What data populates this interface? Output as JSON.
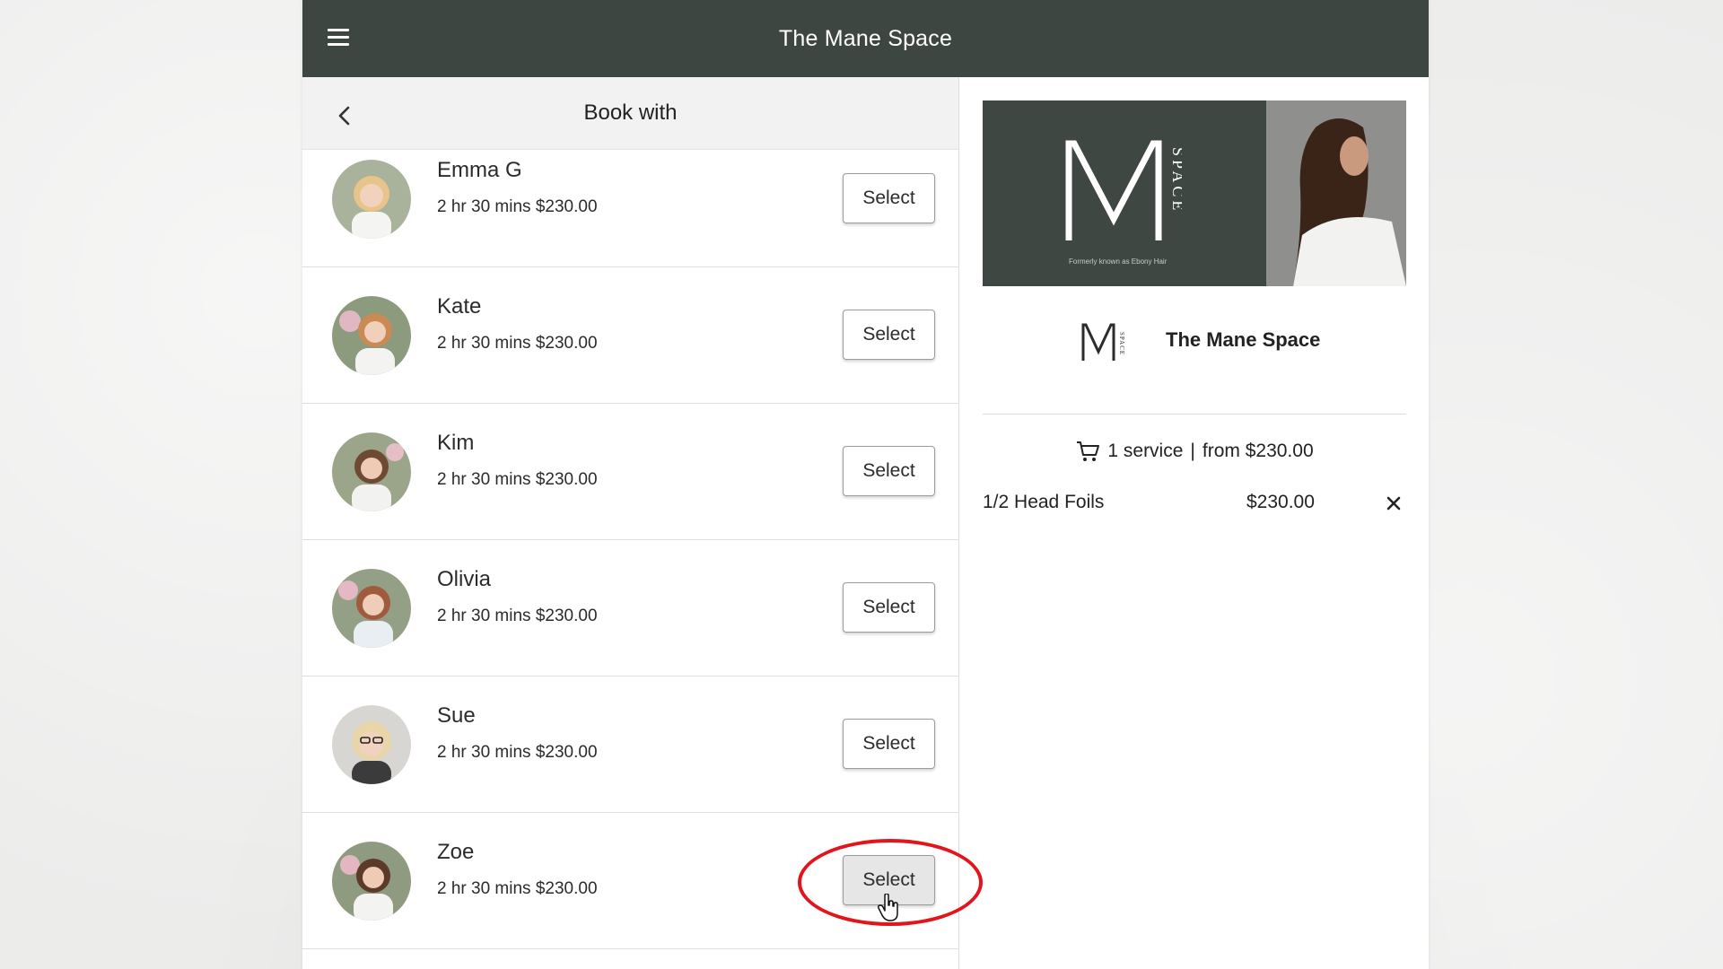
{
  "header": {
    "title": "The Mane Space"
  },
  "subheader": {
    "title": "Book with"
  },
  "staff": [
    {
      "name": "Emma G",
      "detail": "2 hr 30 mins $230.00",
      "select_label": "Select"
    },
    {
      "name": "Kate",
      "detail": "2 hr 30 mins $230.00",
      "select_label": "Select"
    },
    {
      "name": "Kim",
      "detail": "2 hr 30 mins $230.00",
      "select_label": "Select"
    },
    {
      "name": "Olivia",
      "detail": "2 hr 30 mins $230.00",
      "select_label": "Select"
    },
    {
      "name": "Sue",
      "detail": "2 hr 30 mins $230.00",
      "select_label": "Select"
    },
    {
      "name": "Zoe",
      "detail": "2 hr 30 mins $230.00",
      "select_label": "Select"
    }
  ],
  "business": {
    "banner_tagline": "Formerly known as Ebony Hair",
    "name": "The Mane Space"
  },
  "cart": {
    "count_text": "1 service",
    "separator": "|",
    "total_text": "from $230.00",
    "items": [
      {
        "name": "1/2 Head Foils",
        "price": "$230.00"
      }
    ]
  },
  "colors": {
    "header_bg": "#3e4641",
    "highlight": "#e3141b"
  },
  "icons": [
    "menu-icon",
    "back-arrow-icon",
    "cart-icon",
    "close-icon",
    "pointer-cursor-icon"
  ]
}
